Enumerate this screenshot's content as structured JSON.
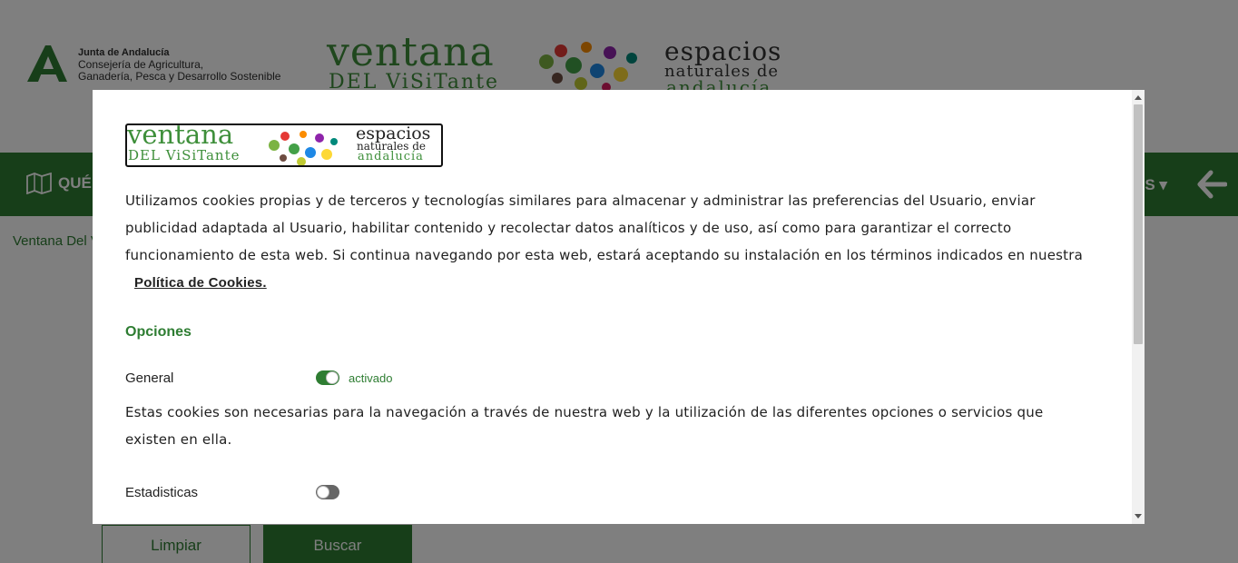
{
  "header": {
    "junta_title": "Junta de Andalucía",
    "junta_sub_line1": "Consejería de Agricultura,",
    "junta_sub_line2": "Ganadería, Pesca y Desarrollo Sostenible",
    "logo_ventana": "ventana",
    "logo_del_visitante": "DEL ViSiTante",
    "logo_espacios": "espacios",
    "logo_naturales": "naturales de",
    "logo_andalucia": "andalucía"
  },
  "navbar": {
    "left_label": "QUÉ",
    "right_label": "ES ▾",
    "back_icon": "arrow-left-icon"
  },
  "breadcrumb": {
    "text": "Ventana Del V"
  },
  "form_buttons": {
    "clear_label": "Limpiar",
    "search_label": "Buscar"
  },
  "modal": {
    "intro": "Utilizamos cookies propias y de terceros y tecnologías similares para almacenar y administrar las preferencias del Usuario, enviar publicidad adaptada al Usuario, habilitar contenido y recolectar datos analíticos y de uso, así como para garantizar el correcto funcionamiento de esta web. Si continua navegando por esta web, estará aceptando su instalación en los términos indicados en nuestra",
    "policy_link": "Política de Cookies.",
    "options_title": "Opciones",
    "options": [
      {
        "label": "General",
        "enabled": true,
        "state_label": "activado",
        "description": "Estas cookies son necesarias para la navegación a través de nuestra web y la utilización de las diferentes opciones o servicios que existen en ella."
      },
      {
        "label": "Estadisticas",
        "enabled": false,
        "state_label": ""
      }
    ]
  },
  "colors": {
    "brand_green": "#2e7d32",
    "overlay": "rgba(0,0,0,0.5)"
  }
}
